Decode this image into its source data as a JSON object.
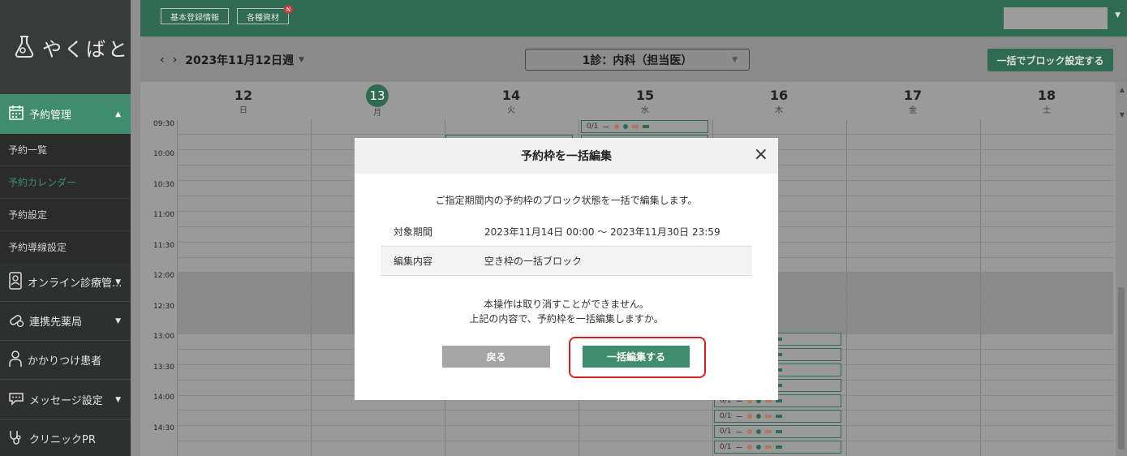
{
  "sidebar": {
    "logo_text": "やくばと",
    "sections": [
      {
        "label": "予約管理",
        "icon": "calendar-icon",
        "expanded": true
      },
      {
        "label": "オンライン診療管...",
        "icon": "tablet-icon"
      },
      {
        "label": "連携先薬局",
        "icon": "pill-icon"
      },
      {
        "label": "かかりつけ患者",
        "icon": "person-icon"
      },
      {
        "label": "メッセージ設定",
        "icon": "chat-icon"
      },
      {
        "label": "クリニックPR",
        "icon": "stethoscope-icon"
      }
    ],
    "sub_items": [
      {
        "label": "予約一覧"
      },
      {
        "label": "予約カレンダー",
        "active": true
      },
      {
        "label": "予約設定"
      },
      {
        "label": "予約導線設定"
      }
    ]
  },
  "header": {
    "basic_info": "基本登録情報",
    "materials": "各種資材",
    "badge": "N"
  },
  "toolbar": {
    "week_label": "2023年11月12日週",
    "department": "1診：内科（担当医）",
    "bulk_block_button": "一括でブロック設定する"
  },
  "calendar": {
    "days": [
      {
        "num": "12",
        "weekday": "日"
      },
      {
        "num": "13",
        "weekday": "月",
        "today": true
      },
      {
        "num": "14",
        "weekday": "火"
      },
      {
        "num": "15",
        "weekday": "水"
      },
      {
        "num": "16",
        "weekday": "木"
      },
      {
        "num": "17",
        "weekday": "金"
      },
      {
        "num": "18",
        "weekday": "土"
      }
    ],
    "times": [
      "09:30",
      "10:00",
      "10:30",
      "11:00",
      "11:30",
      "12:00",
      "12:30",
      "13:00",
      "13:30",
      "14:00",
      "14:30"
    ],
    "slot_count": "0/1",
    "slot_dash": "ー"
  },
  "modal": {
    "title": "予約枠を一括編集",
    "description": "ご指定期間内の予約枠のブロック状態を一括で編集します。",
    "period_label": "対象期間",
    "period_value": "2023年11月14日 00:00 〜 2023年11月30日 23:59",
    "content_label": "編集内容",
    "content_value": "空き枠の一括ブロック",
    "warning_line1": "本操作は取り消すことができません。",
    "warning_line2": "上記の内容で、予約枠を一括編集しますか。",
    "back_button": "戻る",
    "confirm_button": "一括編集する",
    "close_symbol": "×"
  }
}
